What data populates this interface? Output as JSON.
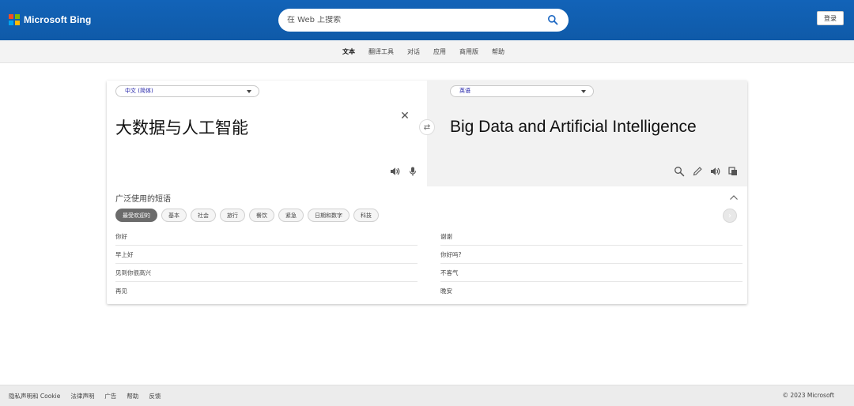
{
  "header": {
    "brand": "Microsoft Bing",
    "logo_colors": [
      "#f25022",
      "#7fba00",
      "#00a4ef",
      "#ffb900"
    ],
    "search_placeholder": "在 Web 上搜索",
    "login_label": "登录"
  },
  "nav": {
    "items": [
      "文本",
      "翻译工具",
      "对话",
      "应用",
      "商用版",
      "帮助"
    ],
    "active": "文本"
  },
  "translator": {
    "source_language": "中文 (简体)",
    "target_language": "英语",
    "source_text": "大数据与人工智能",
    "target_text": "Big Data and Artificial Intelligence"
  },
  "phrases": {
    "title": "广泛使用的短语",
    "categories": [
      "最受欢迎的",
      "基本",
      "社会",
      "旅行",
      "餐饮",
      "紧急",
      "日期和数字",
      "科技"
    ],
    "active_category": "最受欢迎的",
    "left": [
      "你好",
      "早上好",
      "见到你很高兴",
      "再见"
    ],
    "right": [
      "谢谢",
      "你好吗?",
      "不客气",
      "晚安"
    ]
  },
  "footer": {
    "links": [
      "隐私声明和 Cookie",
      "法律声明",
      "广告",
      "帮助",
      "反馈"
    ],
    "copyright": "© 2023 Microsoft"
  },
  "colors": {
    "brand_blue": "#1263b8",
    "accent_link": "#1a1aa6"
  }
}
